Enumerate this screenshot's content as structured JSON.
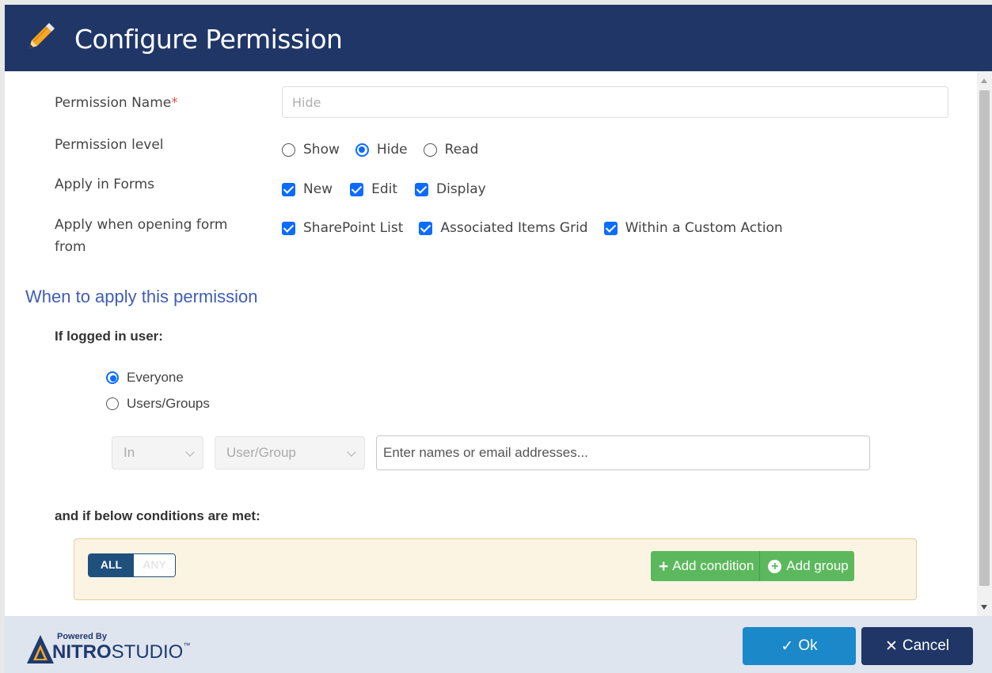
{
  "dialog": {
    "title": "Configure Permission"
  },
  "form": {
    "permission_name_label": "Permission Name",
    "permission_name_required": "*",
    "permission_name_placeholder": "Hide",
    "permission_level_label": "Permission level",
    "permission_level_options": [
      {
        "label": "Show",
        "selected": false
      },
      {
        "label": "Hide",
        "selected": true
      },
      {
        "label": "Read",
        "selected": false
      }
    ],
    "apply_in_forms_label": "Apply in Forms",
    "apply_in_forms_options": [
      {
        "label": "New",
        "checked": true
      },
      {
        "label": "Edit",
        "checked": true
      },
      {
        "label": "Display",
        "checked": true
      }
    ],
    "apply_when_label_line1": "Apply when opening form",
    "apply_when_label_line2": "from",
    "apply_when_options": [
      {
        "label": "SharePoint List",
        "checked": true
      },
      {
        "label": "Associated Items Grid",
        "checked": true
      },
      {
        "label": "Within a Custom Action",
        "checked": true
      }
    ]
  },
  "when": {
    "section_title": "When to apply this permission",
    "logged_in_label": "If logged in user:",
    "user_options": [
      {
        "label": "Everyone",
        "selected": true
      },
      {
        "label": "Users/Groups",
        "selected": false
      }
    ],
    "in_select": "In",
    "usergroup_select": "User/Group",
    "names_placeholder": "Enter names or email addresses...",
    "conditions_label": "and if below conditions are met:",
    "toggle_all": "ALL",
    "toggle_any": "ANY",
    "add_condition": "Add condition",
    "add_group": "Add group"
  },
  "footer": {
    "powered_by": "Powered By",
    "brand_bold": "NITRO",
    "brand_rest": "STUDIO",
    "tm": "™",
    "ok": "Ok",
    "cancel": "Cancel"
  },
  "colors": {
    "header_bg": "#1f3667",
    "accent_blue": "#0b6cff",
    "green": "#5cb85c",
    "ok_blue": "#1a88c9"
  }
}
